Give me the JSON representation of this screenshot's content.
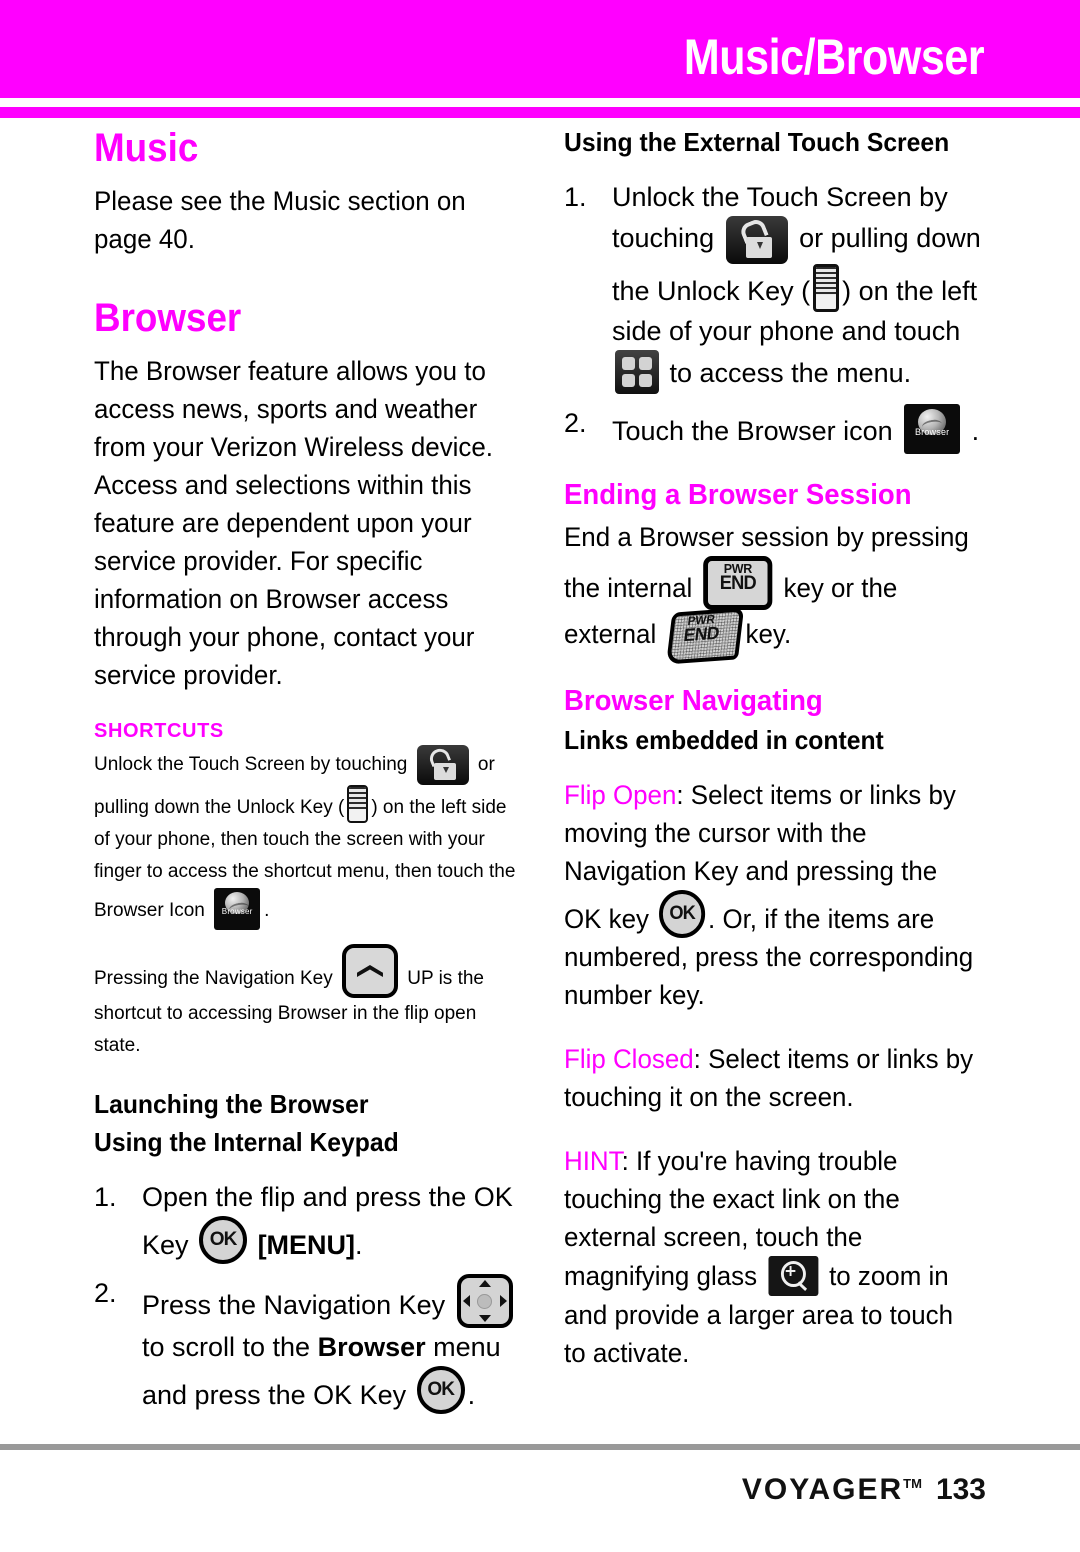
{
  "header": {
    "title": "Music/Browser",
    "bar_color": "#ff00ff"
  },
  "left_column": {
    "music_heading": "Music",
    "music_paragraph": "Please see the Music section on page 40.",
    "browser_heading": "Browser",
    "browser_paragraph": "The Browser feature allows you to access news, sports and weather from your Verizon Wireless device. Access and selections within this feature are dependent upon your service provider. For specific information on Browser access through your phone, contact your service provider.",
    "shortcuts": {
      "label": "SHORTCUTS",
      "para1_a": "Unlock the Touch Screen by touching",
      "para1_b": "or pulling down the Unlock Key (",
      "para1_c": ") on the left side of your phone, then touch the screen with your finger to access the shortcut menu, then touch the Browser Icon",
      "para1_d": ".",
      "para2_a": "Pressing the Navigation Key",
      "para2_b": "UP is the shortcut to accessing Browser in the flip open state."
    },
    "launching_heading": "Launching the Browser",
    "internal_keypad_heading": "Using the Internal Keypad",
    "steps": [
      {
        "num": "1.",
        "text_a": "Open the flip and press the OK Key",
        "text_b": "[MENU]",
        "text_c": "."
      },
      {
        "num": "2.",
        "text_a": "Press the Navigation Key",
        "text_b": "to scroll to the",
        "text_bold": "Browser",
        "text_c": "menu and press the OK Key",
        "text_d": "."
      }
    ]
  },
  "right_column": {
    "external_touch_heading": "Using the External Touch Screen",
    "steps": [
      {
        "num": "1.",
        "text_a": "Unlock the Touch Screen by touching",
        "text_b": "or pulling down the Unlock Key (",
        "text_c": ") on the left side of your phone and touch",
        "text_d": "to access the menu."
      },
      {
        "num": "2.",
        "text_a": "Touch the Browser icon",
        "text_b": "."
      }
    ],
    "ending_session_heading": "Ending a Browser Session",
    "ending_session_a": "End a Browser session by pressing the internal",
    "ending_session_b": "key or the external",
    "ending_session_c": "key.",
    "navigating_heading": "Browser Navigating",
    "links_heading": "Links embedded in content",
    "flip_open_label": "Flip Open",
    "flip_open_a": ": Select items or links by moving the cursor with the Navigation Key and pressing the OK key",
    "flip_open_b": ". Or, if the items are numbered, press the corresponding number key.",
    "flip_closed_label": "Flip Closed",
    "flip_closed_text": ": Select items or links by touching it on the screen.",
    "hint_label": "HINT",
    "hint_a": ": If you're having trouble touching the exact link on the external screen, touch the magnifying glass",
    "hint_b": "to zoom in and provide a larger area to touch to activate."
  },
  "icons": {
    "unlock": "unlock-padlock-icon",
    "unlock_key": "unlock-slider-key-icon",
    "menu_grid": "menu-grid-icon",
    "browser_tile": "browser-globe-icon",
    "browser_tile_label": "Browser",
    "ok_key": "ok-key-icon",
    "ok_key_label": "OK",
    "nav_key": "navigation-4way-key-icon",
    "nav_up_key": "navigation-up-key-icon",
    "pwr_end": "pwr-end-key-icon",
    "pwr_label": "PWR",
    "end_label": "END",
    "magnifier": "magnifying-glass-zoom-icon"
  },
  "footer": {
    "brand": "VOYAGER",
    "trademark": "TM",
    "page_number": "133"
  }
}
